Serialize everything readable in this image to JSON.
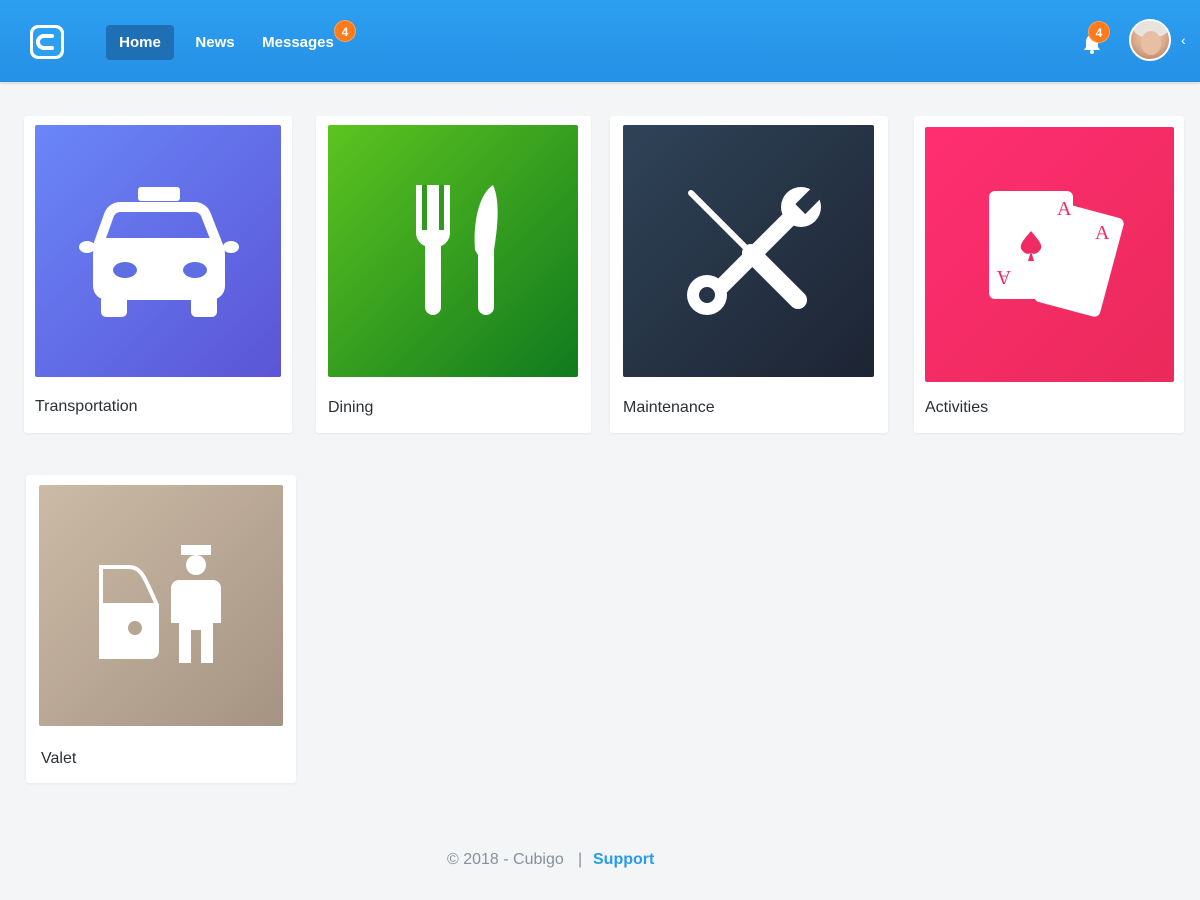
{
  "topbar": {
    "logo_icon": "cubigo-logo-icon",
    "tabs": [
      {
        "label": "Home",
        "active": true
      },
      {
        "label": "News",
        "active": false
      },
      {
        "label": "Messages",
        "active": false,
        "badge": "4"
      }
    ],
    "notifications": {
      "icon": "bell-icon",
      "badge": "4"
    },
    "avatar": "user-avatar",
    "menu_icon": "chevron-left-icon"
  },
  "services": [
    {
      "label": "Transportation",
      "icon": "taxi-icon",
      "color_from": "#6a86f8",
      "color_to": "#5b55d6"
    },
    {
      "label": "Dining",
      "icon": "fork-knife-icon",
      "color_from": "#5cc41f",
      "color_to": "#117a1f"
    },
    {
      "label": "Maintenance",
      "icon": "tools-icon",
      "color_from": "#2f4358",
      "color_to": "#1d2433"
    },
    {
      "label": "Activities",
      "icon": "playing-cards-icon",
      "color_from": "#ff2e72",
      "color_to": "#ea2a5a"
    },
    {
      "label": "Valet",
      "icon": "valet-icon",
      "color_from": "#cbbba6",
      "color_to": "#a69483"
    }
  ],
  "footer": {
    "copyright": "© 2018 - Cubigo",
    "separator": "|",
    "support_label": "Support",
    "support_color": "#2b9be8"
  },
  "colors": {
    "topbar": "#2d9ff0",
    "active_tab": "#1e6fb3",
    "badge": "#ff7a1a",
    "background": "#f3f5f7"
  }
}
